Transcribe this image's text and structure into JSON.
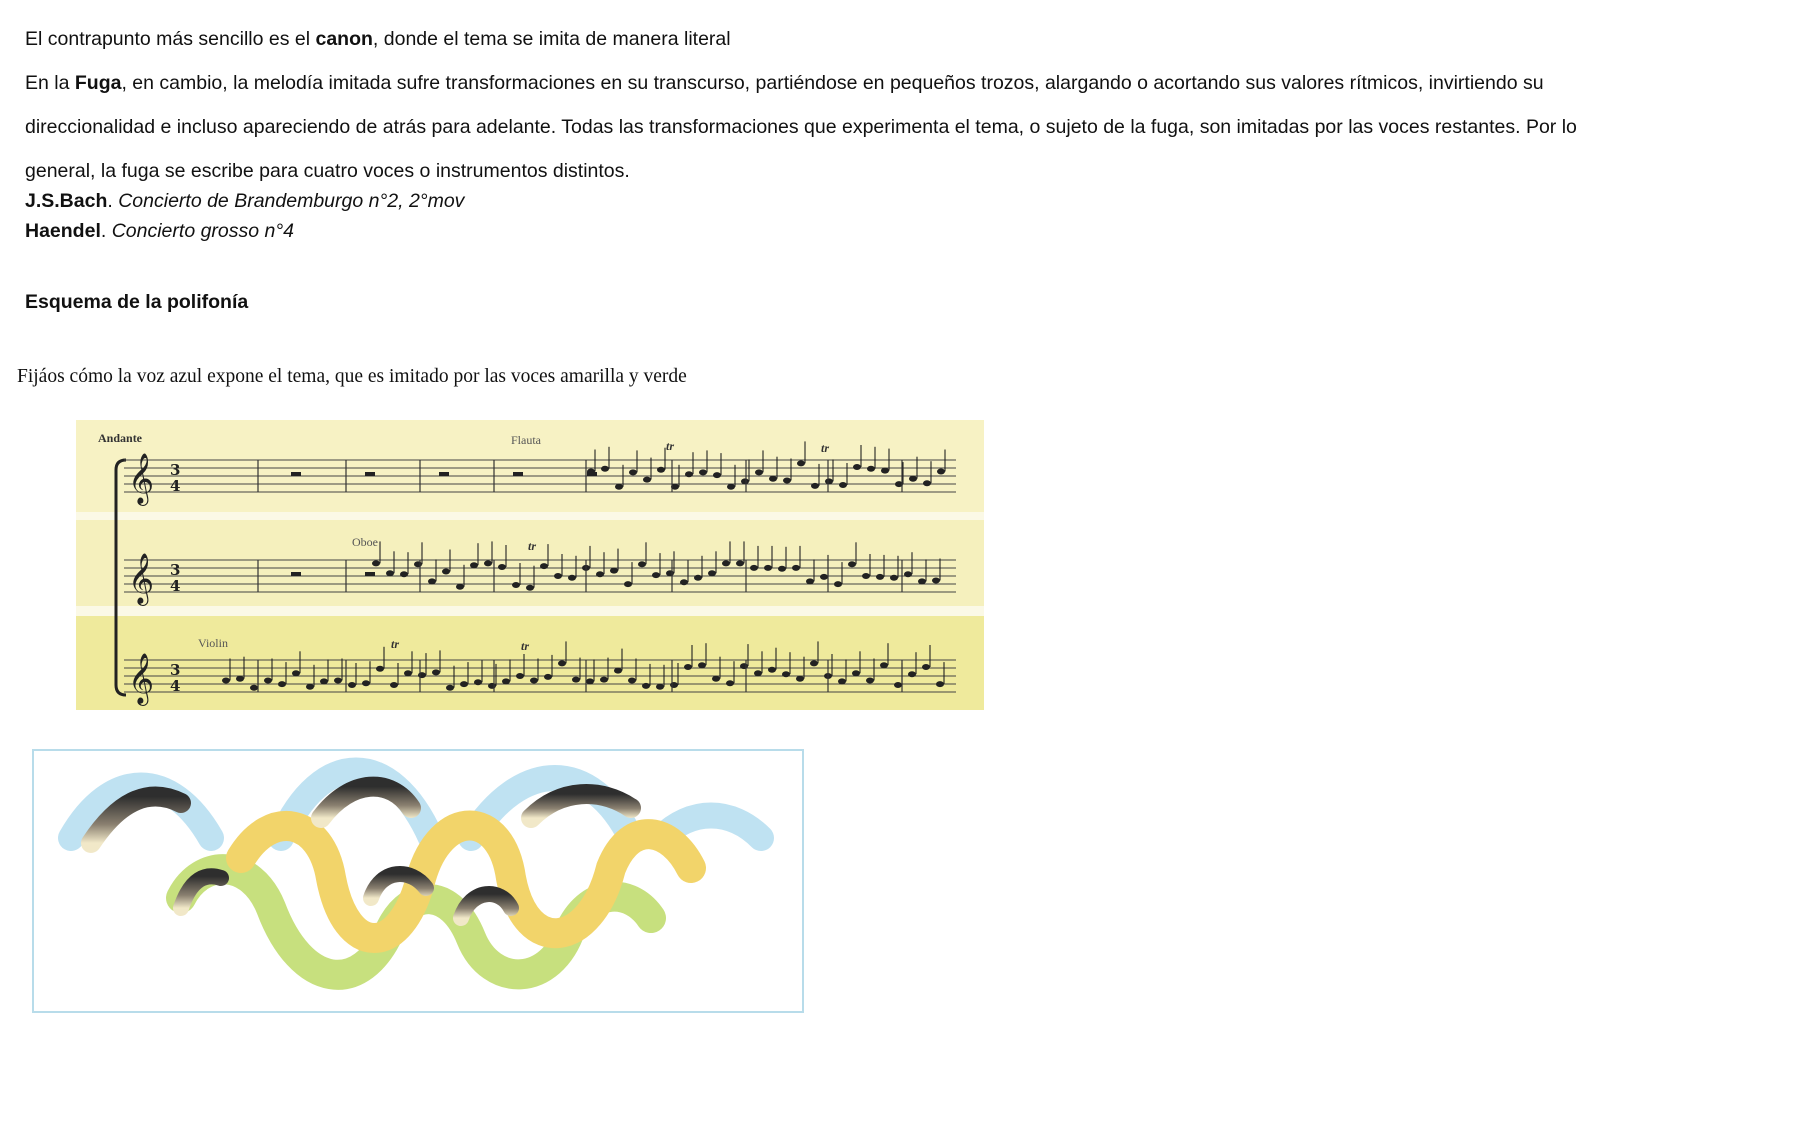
{
  "paragraph1": {
    "pre": "El contrapunto más sencillo es el ",
    "bold": "canon",
    "post": ", donde el tema se imita de manera literal"
  },
  "paragraph2": {
    "pre": "En la ",
    "bold": "Fuga",
    "line1_post": ", en cambio, la melodía imitada sufre transformaciones en su transcurso, partiéndose en pequeños trozos, alargando o acortando sus valores rítmicos, invirtiendo su",
    "line2": "direccionalidad e incluso apareciendo de atrás para adelante. Todas las transformaciones que experimenta el tema, o sujeto de la fuga, son imitadas por las voces restantes. Por lo",
    "line3": "general, la fuga se escribe para cuatro voces o instrumentos distintos."
  },
  "references": [
    {
      "composer": "J.S.Bach",
      "sep": ". ",
      "work": "Concierto de Brandemburgo n°2, 2°mov"
    },
    {
      "composer": "Haendel",
      "sep": ". ",
      "work": "Concierto grosso n°4"
    }
  ],
  "heading": "Esquema de la polifonía",
  "note": "Fijáos cómo la voz azul expone el tema, que es imitado por las voces amarilla y verde",
  "score": {
    "tempo": "Andante",
    "parts": [
      "Flauta",
      "Oboe",
      "Violin"
    ],
    "time_signature": "3/4",
    "trill": "tr",
    "band_colors": [
      "#f7f2c4",
      "#f5f0bd",
      "#efea9c"
    ]
  },
  "wave_colors": {
    "blue": "#bfe2f2",
    "yellow": "#f2d46a",
    "green": "#c7e07e",
    "dark": "#3a3a3a",
    "frame": "#b8dcea"
  }
}
